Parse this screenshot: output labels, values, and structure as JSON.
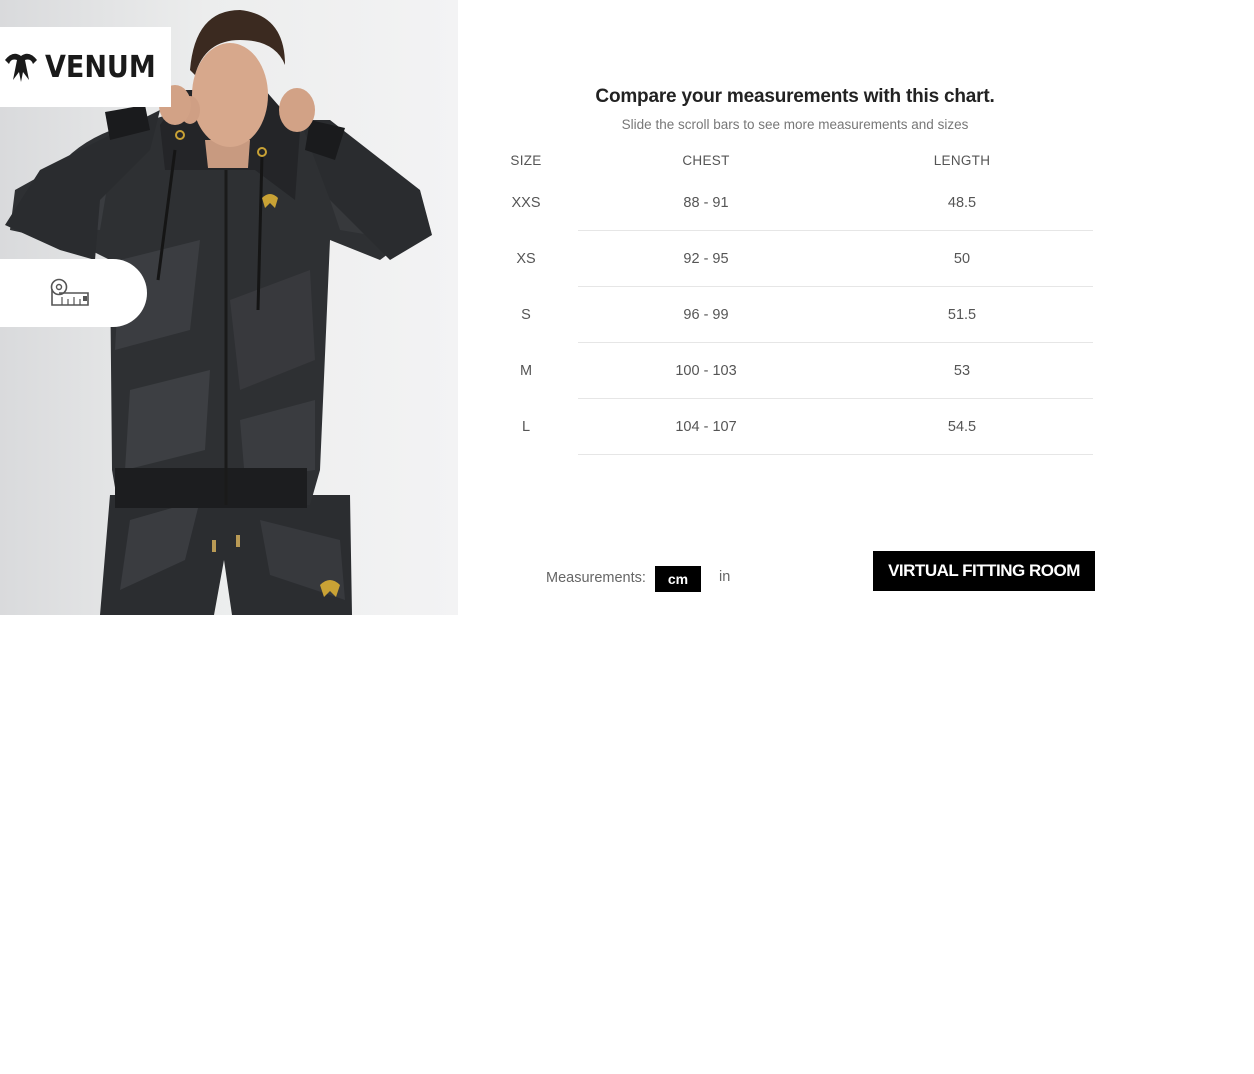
{
  "brand": {
    "logo_text": "VENUM",
    "logo_icon": "venum-snake-head-icon"
  },
  "panel": {
    "tape_icon": "measuring-tape-icon"
  },
  "heading": "Compare your measurements with this chart.",
  "subheading": "Slide the scroll bars to see more measurements and sizes",
  "table": {
    "columns": [
      "SIZE",
      "CHEST",
      "LENGTH"
    ],
    "rows": [
      {
        "size": "XXS",
        "chest": "88 - 91",
        "length": "48.5"
      },
      {
        "size": "XS",
        "chest": "92 - 95",
        "length": "50"
      },
      {
        "size": "S",
        "chest": "96 - 99",
        "length": "51.5"
      },
      {
        "size": "M",
        "chest": "100 - 103",
        "length": "53"
      },
      {
        "size": "L",
        "chest": "104 - 107",
        "length": "54.5"
      }
    ]
  },
  "units": {
    "label": "Measurements:",
    "cm": "cm",
    "in": "in",
    "selected": "cm"
  },
  "virtual_fitting_room": "VIRTUAL FITTING ROOM",
  "colors": {
    "accent": "#000000",
    "gold": "#c9a235",
    "text": "#555555"
  }
}
